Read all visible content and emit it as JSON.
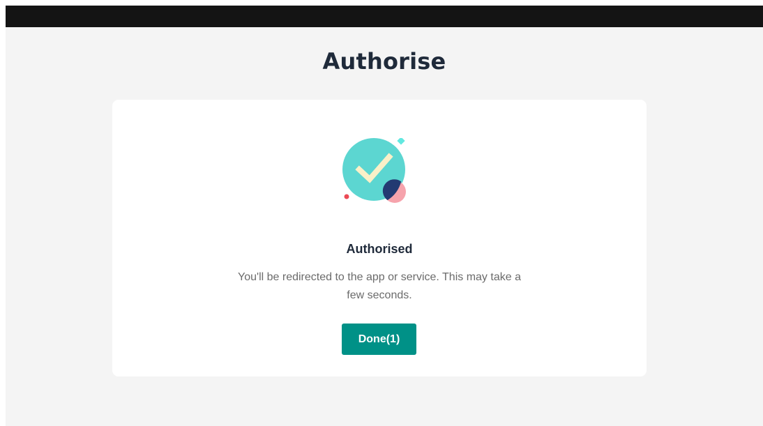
{
  "page": {
    "title": "Authorise"
  },
  "card": {
    "heading": "Authorised",
    "message": "You'll be redirected to the app or service. This may take a few seconds.",
    "done_button_label": "Done(1)"
  },
  "illustration": {
    "icon": "success-check-icon",
    "colors": {
      "circle": "#5cd6d1",
      "check": "#faf0c8",
      "dark_circle": "#233a72",
      "pink_circle": "#f6a3ac",
      "sparkle": "#62e8e0",
      "dot": "#ec4a55"
    }
  },
  "colors": {
    "background": "#f4f4f4",
    "top_bar": "#141414",
    "card": "#ffffff",
    "button": "#009187",
    "title_text": "#1f2a3a",
    "body_text": "#6b6b6b"
  }
}
